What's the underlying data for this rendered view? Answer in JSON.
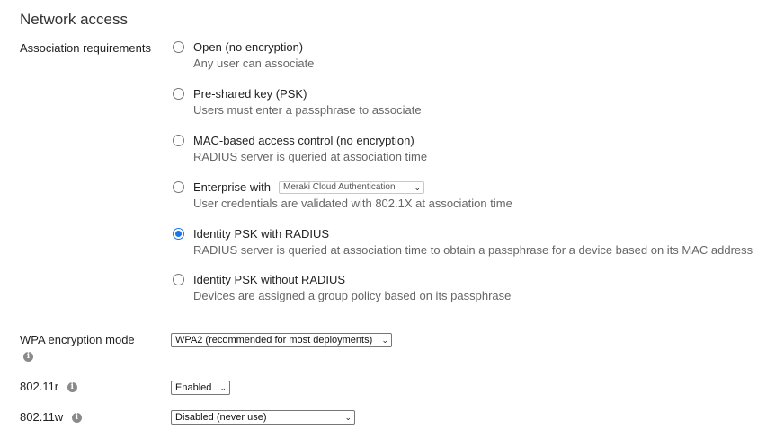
{
  "section": {
    "title": "Network access"
  },
  "association": {
    "label": "Association requirements",
    "options": [
      {
        "title": "Open (no encryption)",
        "desc": "Any user can associate",
        "checked": false
      },
      {
        "title": "Pre-shared key (PSK)",
        "desc": "Users must enter a passphrase to associate",
        "checked": false
      },
      {
        "title": "MAC-based access control (no encryption)",
        "desc": "RADIUS server is queried at association time",
        "checked": false
      },
      {
        "title": "Enterprise with",
        "desc": "User credentials are validated with 802.1X at association time",
        "checked": false,
        "select_value": "Meraki Cloud Authentication"
      },
      {
        "title": "Identity PSK with RADIUS",
        "desc": "RADIUS server is queried at association time to obtain a passphrase for a device based on its MAC address",
        "checked": true
      },
      {
        "title": "Identity PSK without RADIUS",
        "desc": "Devices are assigned a group policy based on its passphrase",
        "checked": false
      }
    ]
  },
  "wpa": {
    "label": "WPA encryption mode",
    "value": "WPA2 (recommended for most deployments)"
  },
  "r80211r": {
    "label": "802.11r",
    "value": "Enabled"
  },
  "r80211w": {
    "label": "802.11w",
    "value": "Disabled (never use)"
  },
  "icons": {
    "info": "info-icon",
    "dropdown": "chevron-down-icon",
    "info_glyph": "i",
    "chevron_glyph": "⌄"
  },
  "colors": {
    "radio_selected": "#1a73e8"
  }
}
